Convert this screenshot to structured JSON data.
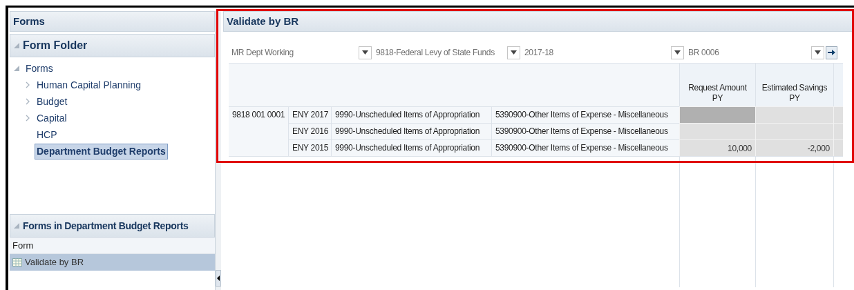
{
  "left_panel": {
    "title": "Forms",
    "folder_section": {
      "title": "Form Folder",
      "expanded": true,
      "tree": [
        {
          "label": "Forms",
          "expanded": true,
          "selected": false,
          "children": [
            {
              "label": "Human Capital Planning",
              "expandable": true,
              "selected": false
            },
            {
              "label": "Budget",
              "expandable": true,
              "selected": false
            },
            {
              "label": "Capital",
              "expandable": true,
              "selected": false
            },
            {
              "label": "HCP",
              "expandable": false,
              "selected": false
            },
            {
              "label": "Department Budget Reports",
              "expandable": false,
              "selected": true
            }
          ]
        }
      ]
    },
    "forms_section": {
      "title": "Forms in Department Budget Reports",
      "expanded": true,
      "column": "Form",
      "items": [
        {
          "label": "Validate by BR",
          "selected": true
        }
      ]
    }
  },
  "form": {
    "title": "Validate by BR",
    "filters": [
      {
        "value": "MR Dept Working"
      },
      {
        "value": "9818-Federal Levy of State Funds"
      },
      {
        "value": "2017-18"
      },
      {
        "value": "BR 0006"
      }
    ],
    "columns": [
      {
        "line1": "Request Amount",
        "line2": "PY"
      },
      {
        "line1": "Estimated Savings",
        "line2": "PY"
      }
    ],
    "rows": [
      {
        "group": "9818 001 0001",
        "year": "ENY 2017",
        "program": "9990-Unscheduled Items of Appropriation",
        "account": "5390900-Other Items of Expense - Miscellaneous",
        "cells": [
          {
            "focused": true
          },
          {
            "focused": false
          }
        ]
      },
      {
        "year": "ENY 2016",
        "program": "9990-Unscheduled Items of Appropriation",
        "account": "5390900-Other Items of Expense - Miscellaneous",
        "cells": [
          {
            "focused": false
          },
          {
            "focused": false
          }
        ]
      },
      {
        "year": "ENY 2015",
        "program": "9990-Unscheduled Items of Appropriation",
        "account": "5390900-Other Items of Expense - Miscellaneous",
        "cells": [
          {
            "value": "10,000",
            "focused": false
          },
          {
            "value": "-2,000",
            "focused": false
          }
        ]
      }
    ]
  }
}
